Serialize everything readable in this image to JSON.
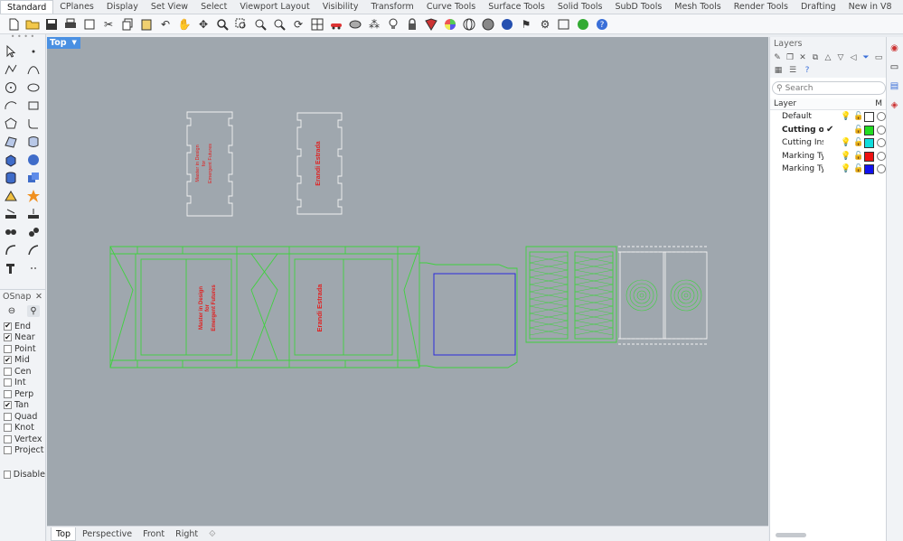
{
  "menu_tabs": [
    "Standard",
    "CPlanes",
    "Display",
    "Set View",
    "Select",
    "Viewport Layout",
    "Visibility",
    "Transform",
    "Curve Tools",
    "Surface Tools",
    "Solid Tools",
    "SubD Tools",
    "Mesh Tools",
    "Render Tools",
    "Drafting",
    "New in V8"
  ],
  "active_tab": "Standard",
  "viewport": {
    "label": "Top",
    "arrow": "▼",
    "background": "#9fa7ae",
    "annotations": {
      "top_left_text": [
        "Master in Design",
        "for",
        "Emergent Futures"
      ],
      "top_right_text": "Erandi Estrada",
      "bottom_left_text": [
        "Master in Design",
        "for",
        "Emergent Futures"
      ],
      "bottom_right_text": "Erandi Estrada"
    }
  },
  "osnap": {
    "title": "OSnap",
    "close": "✕",
    "items": [
      {
        "label": "End",
        "checked": true
      },
      {
        "label": "Near",
        "checked": true
      },
      {
        "label": "Point",
        "checked": false
      },
      {
        "label": "Mid",
        "checked": true
      },
      {
        "label": "Cen",
        "checked": false
      },
      {
        "label": "Int",
        "checked": false
      },
      {
        "label": "Perp",
        "checked": false
      },
      {
        "label": "Tan",
        "checked": true
      },
      {
        "label": "Quad",
        "checked": false
      },
      {
        "label": "Knot",
        "checked": false
      },
      {
        "label": "Vertex",
        "checked": false
      },
      {
        "label": "Project",
        "checked": false
      }
    ],
    "disable": {
      "label": "Disable",
      "checked": false
    }
  },
  "layers": {
    "title": "Layers",
    "search_placeholder": "Search",
    "column_layer": "Layer",
    "column_material": "M",
    "rows": [
      {
        "name": "Default",
        "current": false,
        "color": "#ffffff"
      },
      {
        "name": "Cutting out",
        "current": true,
        "color": "#22dd22"
      },
      {
        "name": "Cutting Inside",
        "current": false,
        "color": "#11dddd"
      },
      {
        "name": "Marking Type",
        "current": false,
        "color": "#ee1111"
      },
      {
        "name": "Marking Type",
        "current": false,
        "color": "#1111ee"
      }
    ]
  },
  "viewport_tabs": [
    "Top",
    "Perspective",
    "Front",
    "Right"
  ],
  "active_viewport_tab": "Top",
  "colors": {
    "accent": "#4a90e2",
    "green_line": "#3fd13f",
    "blue_line": "#2b2bdc",
    "red_text": "#e02020"
  }
}
